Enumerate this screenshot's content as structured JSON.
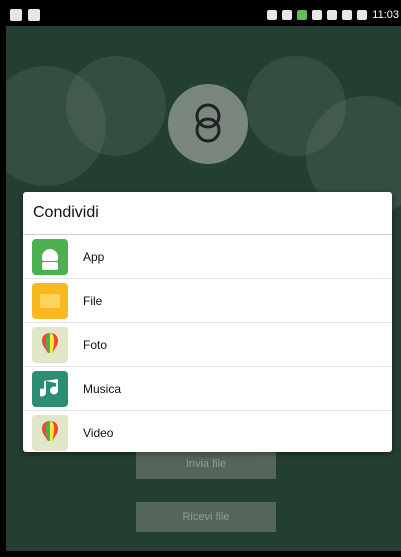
{
  "status_bar": {
    "time": "11:03"
  },
  "dialog": {
    "title": "Condividi",
    "items": [
      {
        "label": "App",
        "icon": "android-app-icon"
      },
      {
        "label": "File",
        "icon": "folder-icon"
      },
      {
        "label": "Foto",
        "icon": "gallery-balloon-icon"
      },
      {
        "label": "Musica",
        "icon": "music-note-icon"
      },
      {
        "label": "Video",
        "icon": "gallery-balloon-icon"
      }
    ]
  },
  "background_buttons": {
    "send": "Invia file",
    "receive": "Ricevi file"
  }
}
